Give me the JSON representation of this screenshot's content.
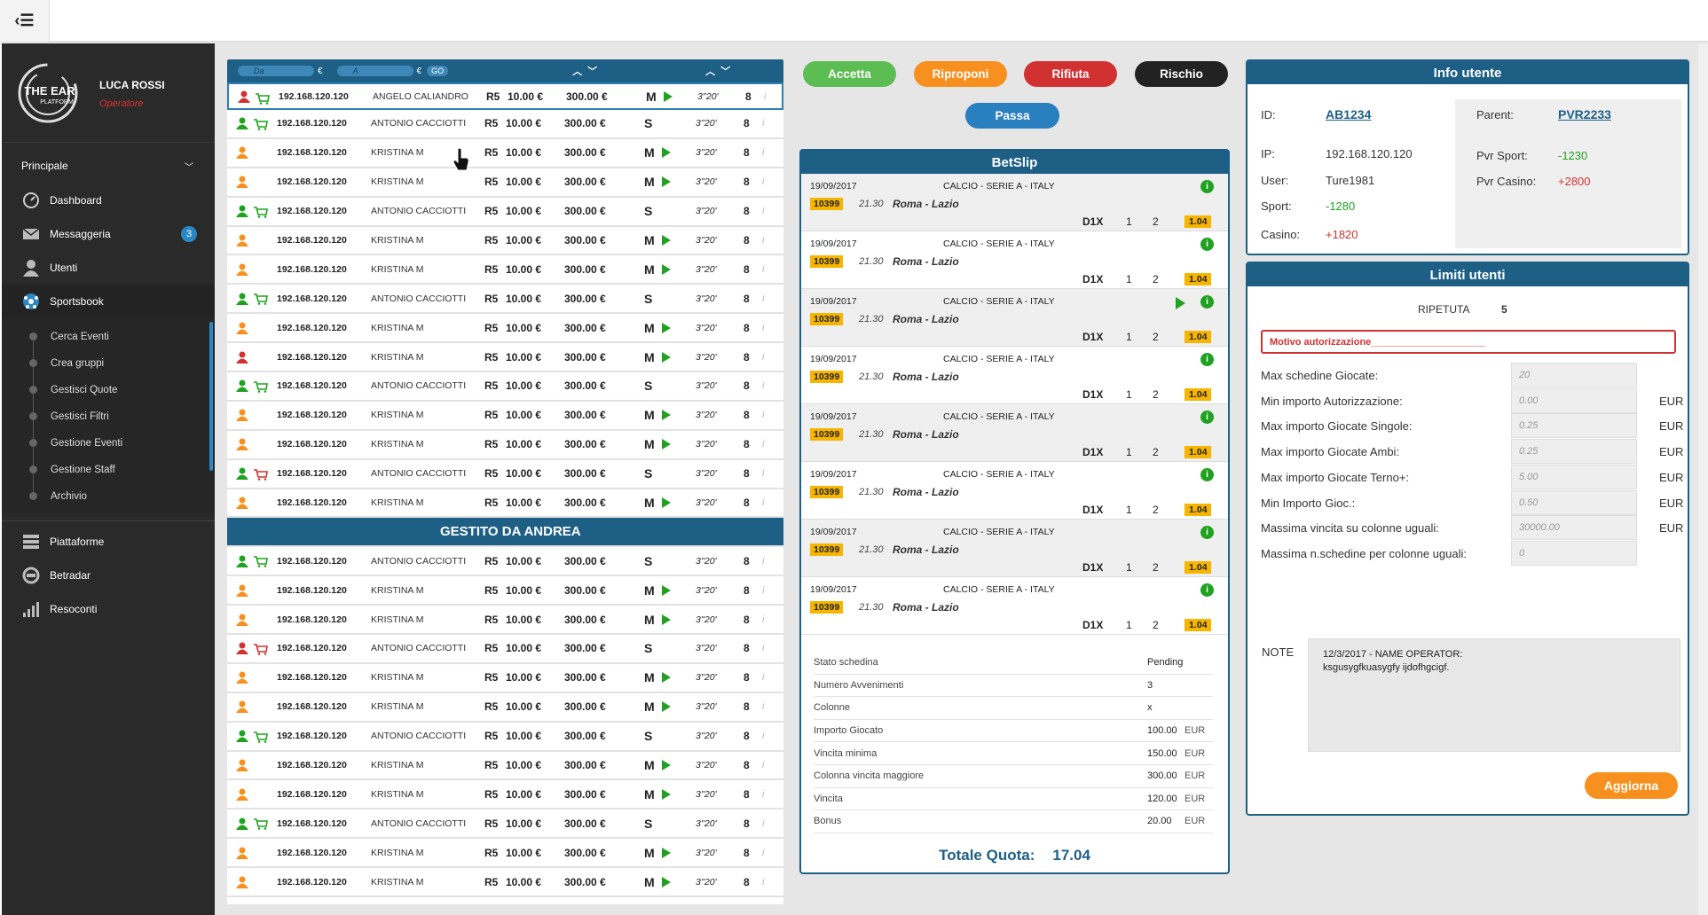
{
  "sidebar": {
    "logo_text": "THE EAR",
    "logo_sub": "PLATFORM",
    "user_name": "LUCA ROSSI",
    "user_role": "Operatore",
    "section_principale": "Principale",
    "items": [
      {
        "label": "Dashboard",
        "icon": "dashboard-icon"
      },
      {
        "label": "Messaggeria",
        "icon": "mail-icon",
        "badge": "3"
      },
      {
        "label": "Utenti",
        "icon": "user-icon"
      },
      {
        "label": "Sportsbook",
        "icon": "soccer-ball-icon"
      }
    ],
    "subitems": [
      "Cerca Eventi",
      "Crea gruppi",
      "Gestisci Quote",
      "Gestisci Filtri",
      "Gestione Eventi",
      "Gestione Staff",
      "Archivio"
    ],
    "bottom_items": [
      {
        "label": "Piattaforme",
        "icon": "stack-icon"
      },
      {
        "label": "Betradar",
        "icon": "betradar-icon"
      },
      {
        "label": "Resoconti",
        "icon": "bar-chart-icon"
      }
    ]
  },
  "filter": {
    "da_placeholder": "Da",
    "a_placeholder": "A",
    "euro": "€",
    "go": "GO"
  },
  "list_rows": [
    {
      "user_color": "#d23131",
      "cart": "green",
      "ip": "192.168.120.120",
      "name": "ANGELO CALIANDRO",
      "r": "R5",
      "stake": "10.00 €",
      "max": "300.00 €",
      "type": "M",
      "play": true,
      "time": "3''20'",
      "n": "8",
      "sel": true
    },
    {
      "user_color": "#21a121",
      "cart": "green",
      "ip": "192.168.120.120",
      "name": "ANTONIO CACCIOTTI",
      "r": "R5",
      "stake": "10.00 €",
      "max": "300.00 €",
      "type": "S",
      "play": false,
      "time": "3''20'",
      "n": "8"
    },
    {
      "user_color": "#f7901e",
      "cart": "",
      "ip": "192.168.120.120",
      "name": "KRISTINA  M",
      "r": "R5",
      "stake": "10.00 €",
      "max": "300.00 €",
      "type": "M",
      "play": true,
      "time": "3''20'",
      "n": "8"
    },
    {
      "user_color": "#f7901e",
      "cart": "",
      "ip": "192.168.120.120",
      "name": "KRISTINA  M",
      "r": "R5",
      "stake": "10.00 €",
      "max": "300.00 €",
      "type": "M",
      "play": true,
      "time": "3''20'",
      "n": "8"
    },
    {
      "user_color": "#21a121",
      "cart": "green",
      "ip": "192.168.120.120",
      "name": "ANTONIO CACCIOTTI",
      "r": "R5",
      "stake": "10.00 €",
      "max": "300.00 €",
      "type": "S",
      "play": false,
      "time": "3''20'",
      "n": "8"
    },
    {
      "user_color": "#f7901e",
      "cart": "",
      "ip": "192.168.120.120",
      "name": "KRISTINA  M",
      "r": "R5",
      "stake": "10.00 €",
      "max": "300.00 €",
      "type": "M",
      "play": true,
      "time": "3''20'",
      "n": "8"
    },
    {
      "user_color": "#f7901e",
      "cart": "",
      "ip": "192.168.120.120",
      "name": "KRISTINA  M",
      "r": "R5",
      "stake": "10.00 €",
      "max": "300.00 €",
      "type": "M",
      "play": true,
      "time": "3''20'",
      "n": "8"
    },
    {
      "user_color": "#21a121",
      "cart": "green",
      "ip": "192.168.120.120",
      "name": "ANTONIO CACCIOTTI",
      "r": "R5",
      "stake": "10.00 €",
      "max": "300.00 €",
      "type": "S",
      "play": false,
      "time": "3''20'",
      "n": "8"
    },
    {
      "user_color": "#f7901e",
      "cart": "",
      "ip": "192.168.120.120",
      "name": "KRISTINA  M",
      "r": "R5",
      "stake": "10.00 €",
      "max": "300.00 €",
      "type": "M",
      "play": true,
      "time": "3''20'",
      "n": "8"
    },
    {
      "user_color": "#d23131",
      "cart": "",
      "ip": "192.168.120.120",
      "name": "KRISTINA  M",
      "r": "R5",
      "stake": "10.00 €",
      "max": "300.00 €",
      "type": "M",
      "play": true,
      "time": "3''20'",
      "n": "8"
    },
    {
      "user_color": "#21a121",
      "cart": "green",
      "ip": "192.168.120.120",
      "name": "ANTONIO CACCIOTTI",
      "r": "R5",
      "stake": "10.00 €",
      "max": "300.00 €",
      "type": "S",
      "play": false,
      "time": "3''20'",
      "n": "8"
    },
    {
      "user_color": "#f7901e",
      "cart": "",
      "ip": "192.168.120.120",
      "name": "KRISTINA  M",
      "r": "R5",
      "stake": "10.00 €",
      "max": "300.00 €",
      "type": "M",
      "play": true,
      "time": "3''20'",
      "n": "8"
    },
    {
      "user_color": "#f7901e",
      "cart": "",
      "ip": "192.168.120.120",
      "name": "KRISTINA  M",
      "r": "R5",
      "stake": "10.00 €",
      "max": "300.00 €",
      "type": "M",
      "play": true,
      "time": "3''20'",
      "n": "8"
    },
    {
      "user_color": "#21a121",
      "cart": "red",
      "ip": "192.168.120.120",
      "name": "ANTONIO CACCIOTTI",
      "r": "R5",
      "stake": "10.00 €",
      "max": "300.00 €",
      "type": "S",
      "play": false,
      "time": "3''20'",
      "n": "8"
    },
    {
      "user_color": "#f7901e",
      "cart": "",
      "ip": "192.168.120.120",
      "name": "KRISTINA  M",
      "r": "R5",
      "stake": "10.00 €",
      "max": "300.00 €",
      "type": "M",
      "play": true,
      "time": "3''20'",
      "n": "8"
    },
    {
      "gestito": true,
      "label": "GESTITO DA ANDREA"
    },
    {
      "user_color": "#21a121",
      "cart": "green",
      "ip": "192.168.120.120",
      "name": "ANTONIO CACCIOTTI",
      "r": "R5",
      "stake": "10.00 €",
      "max": "300.00 €",
      "type": "S",
      "play": false,
      "time": "3''20'",
      "n": "8"
    },
    {
      "user_color": "#f7901e",
      "cart": "",
      "ip": "192.168.120.120",
      "name": "KRISTINA  M",
      "r": "R5",
      "stake": "10.00 €",
      "max": "300.00 €",
      "type": "M",
      "play": true,
      "time": "3''20'",
      "n": "8"
    },
    {
      "user_color": "#f7901e",
      "cart": "",
      "ip": "192.168.120.120",
      "name": "KRISTINA  M",
      "r": "R5",
      "stake": "10.00 €",
      "max": "300.00 €",
      "type": "M",
      "play": true,
      "time": "3''20'",
      "n": "8"
    },
    {
      "user_color": "#d23131",
      "cart": "red",
      "ip": "192.168.120.120",
      "name": "ANTONIO CACCIOTTI",
      "r": "R5",
      "stake": "10.00 €",
      "max": "300.00 €",
      "type": "S",
      "play": false,
      "time": "3''20'",
      "n": "8"
    },
    {
      "user_color": "#f7901e",
      "cart": "",
      "ip": "192.168.120.120",
      "name": "KRISTINA  M",
      "r": "R5",
      "stake": "10.00 €",
      "max": "300.00 €",
      "type": "M",
      "play": true,
      "time": "3''20'",
      "n": "8"
    },
    {
      "user_color": "#f7901e",
      "cart": "",
      "ip": "192.168.120.120",
      "name": "KRISTINA  M",
      "r": "R5",
      "stake": "10.00 €",
      "max": "300.00 €",
      "type": "M",
      "play": true,
      "time": "3''20'",
      "n": "8"
    },
    {
      "user_color": "#21a121",
      "cart": "green",
      "ip": "192.168.120.120",
      "name": "ANTONIO CACCIOTTI",
      "r": "R5",
      "stake": "10.00 €",
      "max": "300.00 €",
      "type": "S",
      "play": false,
      "time": "3''20'",
      "n": "8"
    },
    {
      "user_color": "#f7901e",
      "cart": "",
      "ip": "192.168.120.120",
      "name": "KRISTINA  M",
      "r": "R5",
      "stake": "10.00 €",
      "max": "300.00 €",
      "type": "M",
      "play": true,
      "time": "3''20'",
      "n": "8"
    },
    {
      "user_color": "#f7901e",
      "cart": "",
      "ip": "192.168.120.120",
      "name": "KRISTINA  M",
      "r": "R5",
      "stake": "10.00 €",
      "max": "300.00 €",
      "type": "M",
      "play": true,
      "time": "3''20'",
      "n": "8"
    },
    {
      "user_color": "#21a121",
      "cart": "green",
      "ip": "192.168.120.120",
      "name": "ANTONIO CACCIOTTI",
      "r": "R5",
      "stake": "10.00 €",
      "max": "300.00 €",
      "type": "S",
      "play": false,
      "time": "3''20'",
      "n": "8"
    },
    {
      "user_color": "#f7901e",
      "cart": "",
      "ip": "192.168.120.120",
      "name": "KRISTINA  M",
      "r": "R5",
      "stake": "10.00 €",
      "max": "300.00 €",
      "type": "M",
      "play": true,
      "time": "3''20'",
      "n": "8"
    },
    {
      "user_color": "#f7901e",
      "cart": "",
      "ip": "192.168.120.120",
      "name": "KRISTINA  M",
      "r": "R5",
      "stake": "10.00 €",
      "max": "300.00 €",
      "type": "M",
      "play": true,
      "time": "3''20'",
      "n": "8"
    }
  ],
  "actions": {
    "accetta": "Accetta",
    "riproponi": "Riproponi",
    "rifiuta": "Rifiuta",
    "rischio": "Rischio",
    "passa": "Passa"
  },
  "betslip": {
    "title": "BetSlip",
    "bets": [
      {
        "date": "19/09/2017",
        "league": "CALCIO - SERIE A - ITALY",
        "code": "10399",
        "time": "21.30",
        "match": "Roma - Lazio",
        "sign": "D1X",
        "o1": "1",
        "o2": "2",
        "quota": "1.04",
        "play": false
      },
      {
        "date": "19/09/2017",
        "league": "CALCIO - SERIE A - ITALY",
        "code": "10399",
        "time": "21.30",
        "match": "Roma - Lazio",
        "sign": "D1X",
        "o1": "1",
        "o2": "2",
        "quota": "1.04",
        "play": false
      },
      {
        "date": "19/09/2017",
        "league": "CALCIO - SERIE A - ITALY",
        "code": "10399",
        "time": "21.30",
        "match": "Roma - Lazio",
        "sign": "D1X",
        "o1": "1",
        "o2": "2",
        "quota": "1.04",
        "play": true
      },
      {
        "date": "19/09/2017",
        "league": "CALCIO - SERIE A - ITALY",
        "code": "10399",
        "time": "21.30",
        "match": "Roma - Lazio",
        "sign": "D1X",
        "o1": "1",
        "o2": "2",
        "quota": "1.04",
        "play": false
      },
      {
        "date": "19/09/2017",
        "league": "CALCIO - SERIE A - ITALY",
        "code": "10399",
        "time": "21.30",
        "match": "Roma - Lazio",
        "sign": "D1X",
        "o1": "1",
        "o2": "2",
        "quota": "1.04",
        "play": false
      },
      {
        "date": "19/09/2017",
        "league": "CALCIO - SERIE A - ITALY",
        "code": "10399",
        "time": "21.30",
        "match": "Roma - Lazio",
        "sign": "D1X",
        "o1": "1",
        "o2": "2",
        "quota": "1.04",
        "play": false
      },
      {
        "date": "19/09/2017",
        "league": "CALCIO - SERIE A - ITALY",
        "code": "10399",
        "time": "21.30",
        "match": "Roma - Lazio",
        "sign": "D1X",
        "o1": "1",
        "o2": "2",
        "quota": "1.04",
        "play": false
      },
      {
        "date": "19/09/2017",
        "league": "CALCIO - SERIE A - ITALY",
        "code": "10399",
        "time": "21.30",
        "match": "Roma - Lazio",
        "sign": "D1X",
        "o1": "1",
        "o2": "2",
        "quota": "1.04",
        "play": false
      }
    ],
    "summary": [
      {
        "label": "Stato schedina",
        "value": "Pending",
        "cur": ""
      },
      {
        "label": "Numero Avvenimenti",
        "value": "3",
        "cur": ""
      },
      {
        "label": "Colonne",
        "value": "x",
        "cur": ""
      },
      {
        "label": "Importo Giocato",
        "value": "100.00",
        "cur": "EUR"
      },
      {
        "label": "Vincita minima",
        "value": "150.00",
        "cur": "EUR"
      },
      {
        "label": "Colonna vincita maggiore",
        "value": "300.00",
        "cur": "EUR"
      },
      {
        "label": "Vincita",
        "value": "120.00",
        "cur": "EUR"
      },
      {
        "label": "Bonus",
        "value": "20.00",
        "cur": "EUR"
      }
    ],
    "totale_label": "Totale Quota:",
    "totale_value": "17.04"
  },
  "info_utente": {
    "title": "Info utente",
    "id_label": "ID:",
    "id_value": "AB1234",
    "ip_label": "IP:",
    "ip_value": "192.168.120.120",
    "user_label": "User:",
    "user_value": "Ture1981",
    "sport_label": "Sport:",
    "sport_value": "-1280",
    "casino_label": "Casino:",
    "casino_value": "+1820",
    "parent_label": "Parent:",
    "parent_value": "PVR2233",
    "pvr_sport_label": "Pvr Sport:",
    "pvr_sport_value": "-1230",
    "pvr_casino_label": "Pvr Casino:",
    "pvr_casino_value": "+2800"
  },
  "limiti": {
    "title": "Limiti utenti",
    "ripetuta_label": "RIPETUTA",
    "ripetuta_value": "5",
    "motivo_placeholder": "Motivo autorizzazione_____________________",
    "fields": [
      {
        "label": "Max schedine Giocate:",
        "value": "20",
        "cur": ""
      },
      {
        "label": "Min importo Autorizzazione:",
        "value": "0.00",
        "cur": "EUR"
      },
      {
        "label": "Max importo Giocate Singole:",
        "value": "0.25",
        "cur": "EUR"
      },
      {
        "label": "Max importo Giocate Ambi:",
        "value": "0.25",
        "cur": "EUR"
      },
      {
        "label": "Max importo Giocate Terno+:",
        "value": "5.00",
        "cur": "EUR"
      },
      {
        "label": "Min Importo Gioc.:",
        "value": "0.50",
        "cur": "EUR"
      },
      {
        "label": "Massima vincita su colonne uguali:",
        "value": "30000.00",
        "cur": "EUR"
      },
      {
        "label": "Massima n.schedine per colonne uguali:",
        "value": "0",
        "cur": ""
      }
    ],
    "note_label": "NOTE",
    "note_line1": "12/3/2017 - NAME OPERATOR:",
    "note_line2": "ksgusygfkuasygfy ijdofhgcigf.",
    "aggiorna": "Aggiorna"
  }
}
